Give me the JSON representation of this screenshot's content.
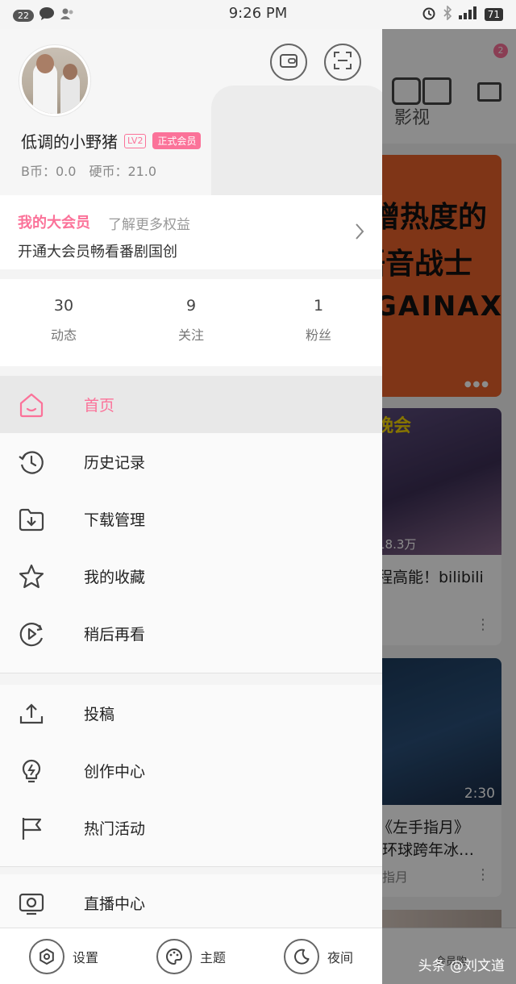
{
  "status_bar": {
    "notification_count": "22",
    "time": "9:26 PM",
    "battery": "71"
  },
  "profile": {
    "username": "低调的小野猪",
    "level": "LV2",
    "vip_badge": "正式会员",
    "b_coin": "B币：0.0",
    "coin": "硬币：21.0"
  },
  "vip_card": {
    "title": "我的大会员",
    "more": "了解更多权益",
    "subtitle": "开通大会员畅看番剧国创"
  },
  "stats": [
    {
      "value": "30",
      "label": "动态"
    },
    {
      "value": "9",
      "label": "关注"
    },
    {
      "value": "1",
      "label": "粉丝"
    }
  ],
  "menu_group_1": [
    {
      "label": "首页",
      "icon": "home-icon",
      "active": true
    },
    {
      "label": "历史记录",
      "icon": "history-icon"
    },
    {
      "label": "下载管理",
      "icon": "download-folder-icon"
    },
    {
      "label": "我的收藏",
      "icon": "star-icon"
    },
    {
      "label": "稍后再看",
      "icon": "watch-later-icon"
    }
  ],
  "menu_group_2": [
    {
      "label": "投稿",
      "icon": "upload-icon"
    },
    {
      "label": "创作中心",
      "icon": "lightbulb-icon"
    },
    {
      "label": "热门活动",
      "icon": "flag-icon"
    }
  ],
  "menu_group_3": [
    {
      "label": "直播中心",
      "icon": "live-tv-icon"
    }
  ],
  "bottom_bar": [
    {
      "label": "设置",
      "icon": "settings-icon"
    },
    {
      "label": "主题",
      "icon": "theme-palette-icon"
    },
    {
      "label": "夜间",
      "icon": "night-moon-icon"
    }
  ],
  "background": {
    "tab_label": "影视",
    "message_badge": "2",
    "banner_line1": "增热度的",
    "banner_line2": "语音战士",
    "banner_line3": "GAINAX",
    "card1_tag": "晚会",
    "card1_meta": "18.3万",
    "card1_title": "程高能！bilibili",
    "card2_meta": "2:30",
    "card2_title_1": "《左手指月》",
    "card2_title_2": "环球跨年冰…",
    "card2_sub": "指月",
    "shop_label": "会员购"
  },
  "watermark": "头条 @刘文道",
  "colors": {
    "accent_pink": "#fb7299",
    "drawer_bg": "#f4f4f4",
    "active_row_bg": "#e8e8e8"
  }
}
